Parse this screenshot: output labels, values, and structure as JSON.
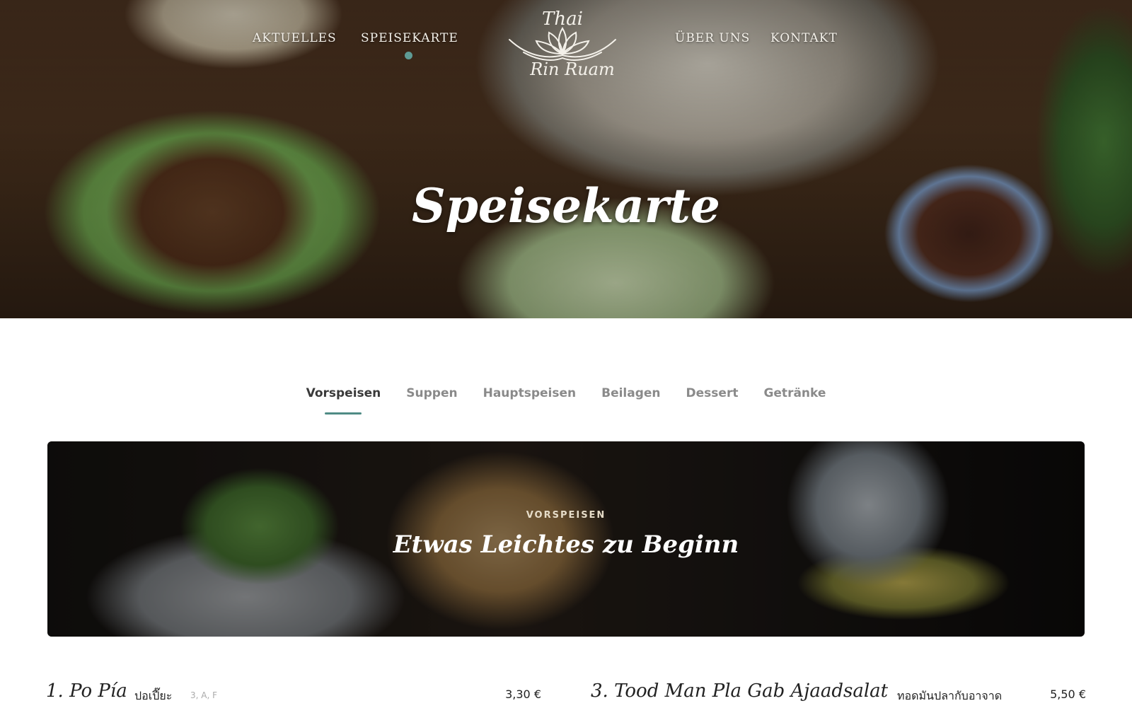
{
  "nav": {
    "items": [
      "AKTUELLES",
      "SPEISEKARTE",
      "ÜBER UNS",
      "KONTAKT"
    ],
    "active": "SPEISEKARTE"
  },
  "logo": {
    "line1": "Thai",
    "line2": "Rin Ruam"
  },
  "hero": {
    "title": "Speisekarte"
  },
  "tabs": [
    "Vorspeisen",
    "Suppen",
    "Hauptspeisen",
    "Beilagen",
    "Dessert",
    "Getränke"
  ],
  "active_tab": "Vorspeisen",
  "category": {
    "kicker": "VORSPEISEN",
    "title": "Etwas Leichtes zu Beginn"
  },
  "items": [
    {
      "name": "1. Po Pía",
      "thai": "ปอเปี๊ยะ",
      "allergens": "3, A, F",
      "price": "3,30 €"
    },
    {
      "name": "3. Tood Man Pla Gab Ajaadsalat",
      "thai": "ทอดมันปลากับอาจาด",
      "price": "5,50 €"
    }
  ],
  "colors": {
    "accent": "#4f8b85",
    "nav_text": "#f4f1ea"
  },
  "icons": [
    "lotus-logo-icon"
  ]
}
